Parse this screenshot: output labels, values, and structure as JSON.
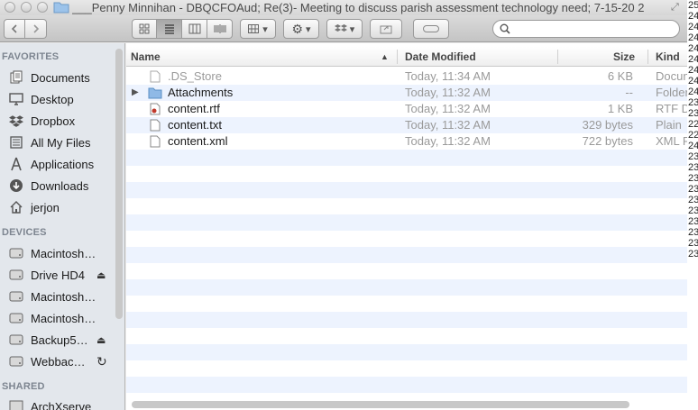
{
  "window": {
    "title": "___Penny Minnihan - DBQCFOAud; Re(3)- Meeting to discuss parish assessment technology need; 7-15-20 2"
  },
  "toolbar": {
    "back_icon": "chevron-left-icon",
    "forward_icon": "chevron-right-icon",
    "view_modes": [
      "icon-view",
      "list-view",
      "column-view",
      "coverflow-view"
    ],
    "active_view": "list-view",
    "search_placeholder": ""
  },
  "sidebar": {
    "favorites_label": "FAVORITES",
    "favorites": [
      {
        "label": "Documents",
        "icon": "documents-icon"
      },
      {
        "label": "Desktop",
        "icon": "desktop-icon"
      },
      {
        "label": "Dropbox",
        "icon": "dropbox-icon"
      },
      {
        "label": "All My Files",
        "icon": "all-files-icon"
      },
      {
        "label": "Applications",
        "icon": "applications-icon"
      },
      {
        "label": "Downloads",
        "icon": "downloads-icon"
      },
      {
        "label": "jerjon",
        "icon": "home-icon"
      }
    ],
    "devices_label": "DEVICES",
    "devices": [
      {
        "label": "Macintosh…",
        "icon": "drive-icon"
      },
      {
        "label": "Drive HD4",
        "icon": "drive-icon",
        "eject": true
      },
      {
        "label": "Macintosh…",
        "icon": "drive-icon"
      },
      {
        "label": "Macintosh…",
        "icon": "drive-icon"
      },
      {
        "label": "Backup5…",
        "icon": "drive-icon",
        "eject": true
      },
      {
        "label": "Webbac…",
        "icon": "drive-icon",
        "sync": true
      }
    ],
    "shared_label": "SHARED",
    "shared": [
      {
        "label": "ArchXserve",
        "icon": "server-icon"
      }
    ]
  },
  "columns": {
    "name": "Name",
    "date_modified": "Date Modified",
    "size": "Size",
    "kind": "Kind"
  },
  "files": [
    {
      "name": ".DS_Store",
      "date": "Today, 11:34 AM",
      "size": "6 KB",
      "kind": "Docum",
      "dim": true,
      "icon": "document-icon"
    },
    {
      "name": "Attachments",
      "date": "Today, 11:32 AM",
      "size": "--",
      "kind": "Folder",
      "folder": true,
      "icon": "folder-icon"
    },
    {
      "name": "content.rtf",
      "date": "Today, 11:32 AM",
      "size": "1 KB",
      "kind": "RTF D",
      "icon": "rtf-document-icon"
    },
    {
      "name": "content.txt",
      "date": "Today, 11:32 AM",
      "size": "329 bytes",
      "kind": "Plain",
      "icon": "document-icon"
    },
    {
      "name": "content.xml",
      "date": "Today, 11:32 AM",
      "size": "722 bytes",
      "kind": "XML F",
      "icon": "document-icon"
    }
  ],
  "background_fragments": [
    "25",
    "24",
    "24",
    "24",
    "24",
    "24",
    "24",
    "24",
    "24",
    "23",
    "23",
    "22",
    "22",
    "24",
    "23",
    "23",
    "23",
    "23",
    "23",
    "23",
    "23",
    "23",
    "23",
    "23"
  ],
  "colors": {
    "sidebar_bg": "#e3e7ec",
    "stripe": "#edf3fe",
    "folder_blue": "#6fa8dc"
  }
}
